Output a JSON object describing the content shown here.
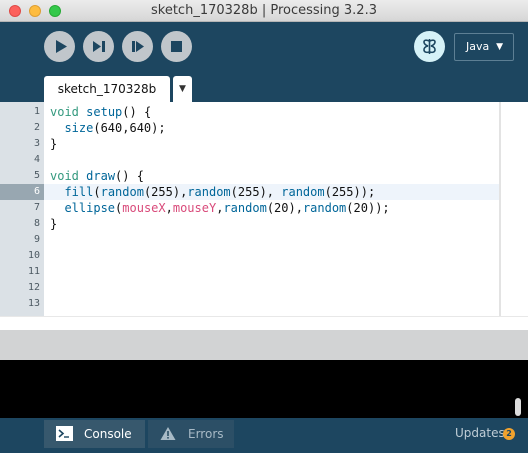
{
  "window": {
    "title": "sketch_170328b | Processing 3.2.3"
  },
  "toolbar": {
    "buttons": [
      {
        "icon": "play-icon"
      },
      {
        "icon": "present-icon"
      },
      {
        "icon": "debug-step-icon"
      },
      {
        "icon": "stop-icon"
      }
    ],
    "mode": "Java"
  },
  "tabs": {
    "active": "sketch_170328b"
  },
  "editor": {
    "line_numbers": [
      "1",
      "2",
      "3",
      "4",
      "5",
      "6",
      "7",
      "8",
      "9",
      "10",
      "11",
      "12",
      "13"
    ],
    "current_line": 6,
    "lines": [
      "void setup() {",
      "  size(640,640);",
      "}",
      "",
      "void draw() {",
      "  fill(random(255),random(255), random(255));",
      "  ellipse(mouseX,mouseY,random(20),random(20));",
      "}"
    ]
  },
  "footer": {
    "console_tab": "Console",
    "errors_tab": "Errors",
    "updates_label": "Updates",
    "updates_count": "2"
  },
  "colors": {
    "toolbar_bg": "#1d4660",
    "keyword": "#33997e",
    "function": "#006699",
    "variable": "#d94a7a",
    "updates_badge": "#f0a22e"
  }
}
